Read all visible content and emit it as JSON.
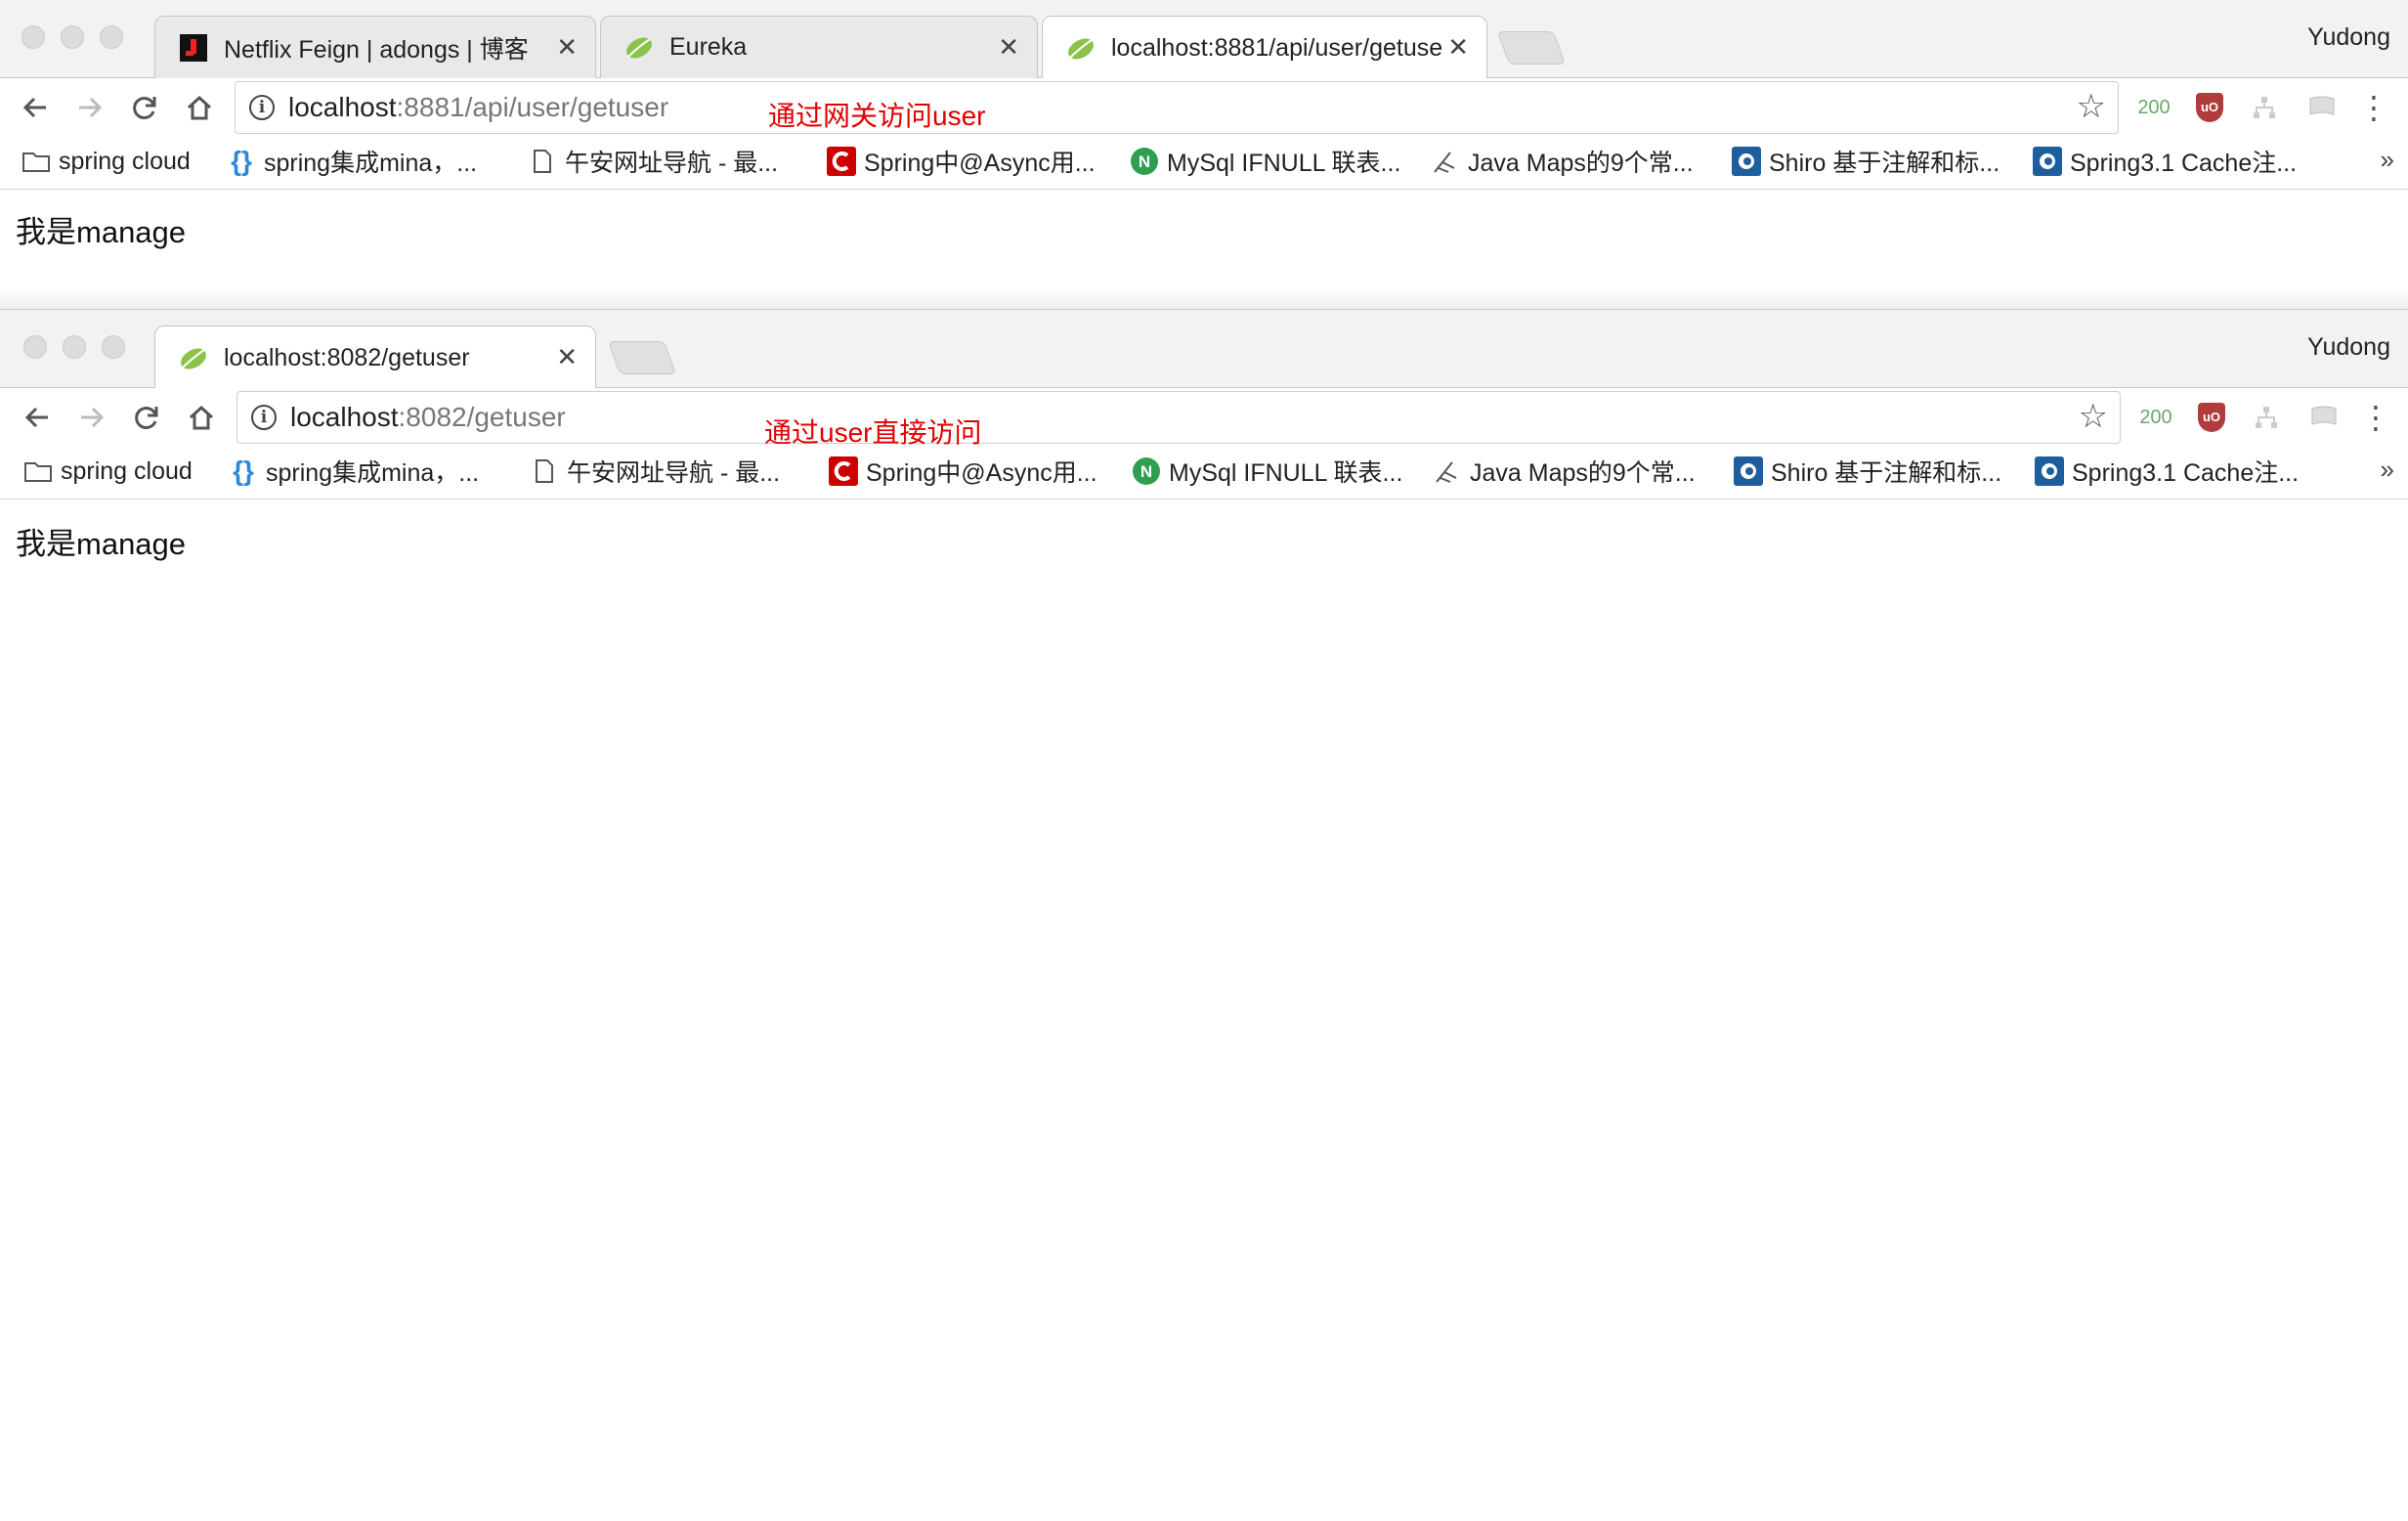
{
  "windows": [
    {
      "tabs": [
        {
          "title": "Netflix Feign | adongs | 博客",
          "icon": "jianshu-icon",
          "active": false
        },
        {
          "title": "Eureka",
          "icon": "spring-leaf-icon",
          "active": false
        },
        {
          "title": "localhost:8881/api/user/getuse",
          "icon": "spring-leaf-icon",
          "active": true
        }
      ],
      "profile": "Yudong",
      "address": {
        "host": "localhost",
        "rest": ":8881/api/user/getuser"
      },
      "annotation": "通过网关访问user",
      "extension_status": "200",
      "content": "我是manage"
    },
    {
      "tabs": [
        {
          "title": "localhost:8082/getuser",
          "icon": "spring-leaf-icon",
          "active": true
        }
      ],
      "profile": "Yudong",
      "address": {
        "host": "localhost",
        "rest": ":8082/getuser"
      },
      "annotation": "通过user直接访问",
      "extension_status": "200",
      "content": "我是manage"
    }
  ],
  "bookmarks": [
    {
      "label": "spring cloud",
      "icon": "folder-icon"
    },
    {
      "label": "spring集成mina，...",
      "icon": "braces-icon"
    },
    {
      "label": "午安网址导航 - 最...",
      "icon": "page-icon"
    },
    {
      "label": "Spring中@Async用...",
      "icon": "csdn-icon"
    },
    {
      "label": "MySql IFNULL 联表...",
      "icon": "n-badge-icon"
    },
    {
      "label": "Java Maps的9个常...",
      "icon": "feather-icon"
    },
    {
      "label": "Shiro 基于注解和标...",
      "icon": "cnblogs-icon"
    },
    {
      "label": "Spring3.1 Cache注...",
      "icon": "cnblogs-icon"
    }
  ],
  "bookmarks_overflow": "»",
  "colors": {
    "annotation": "#e00000",
    "tabstrip": "#f2f2f2",
    "leaf": "#8bc34a"
  }
}
